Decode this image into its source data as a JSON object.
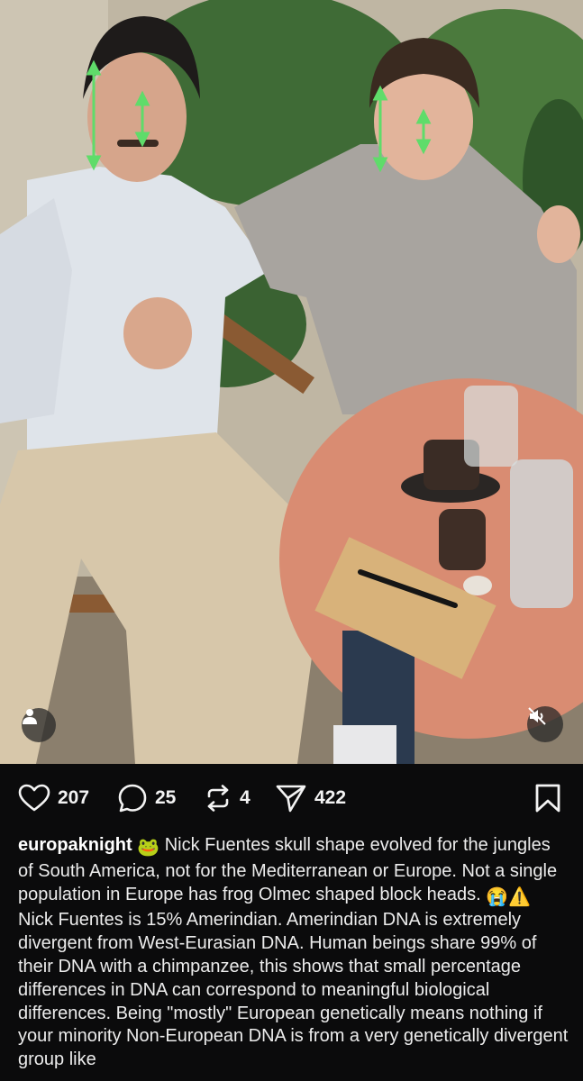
{
  "post": {
    "photo_alt": "",
    "stats": {
      "likes": "207",
      "comments": "25",
      "reposts": "4",
      "shares": "422"
    },
    "caption": {
      "username": "europaknight",
      "emoji_frog": "🐸",
      "text_1": "Nick Fuentes skull shape evolved for the jungles of South America, not for the Mediterranean or Europe. Not a single population in Europe has frog Olmec shaped block heads.",
      "emoji_cry": "😭",
      "emoji_warning": "⚠️",
      "text_2": "Nick Fuentes is 15% Amerindian. Amerindian DNA is extremely divergent from West-Eurasian DNA. Human beings share 99% of their DNA with a chimpanzee, this shows that small percentage differences in DNA can correspond to meaningful biological differences. Being \"mostly\" European genetically means nothing if your minority Non-European DNA is from a very genetically divergent group like"
    }
  },
  "colors": {
    "background": "#0b0b0c",
    "text": "#ececec",
    "accent_arrow": "#5fdc6a",
    "table": "#d98c72"
  },
  "icons": {
    "like": "heart-icon",
    "comment": "comment-icon",
    "repost": "repost-icon",
    "share": "send-icon",
    "save": "bookmark-icon",
    "user_tag": "person-icon",
    "mute": "muted-speaker-icon"
  }
}
